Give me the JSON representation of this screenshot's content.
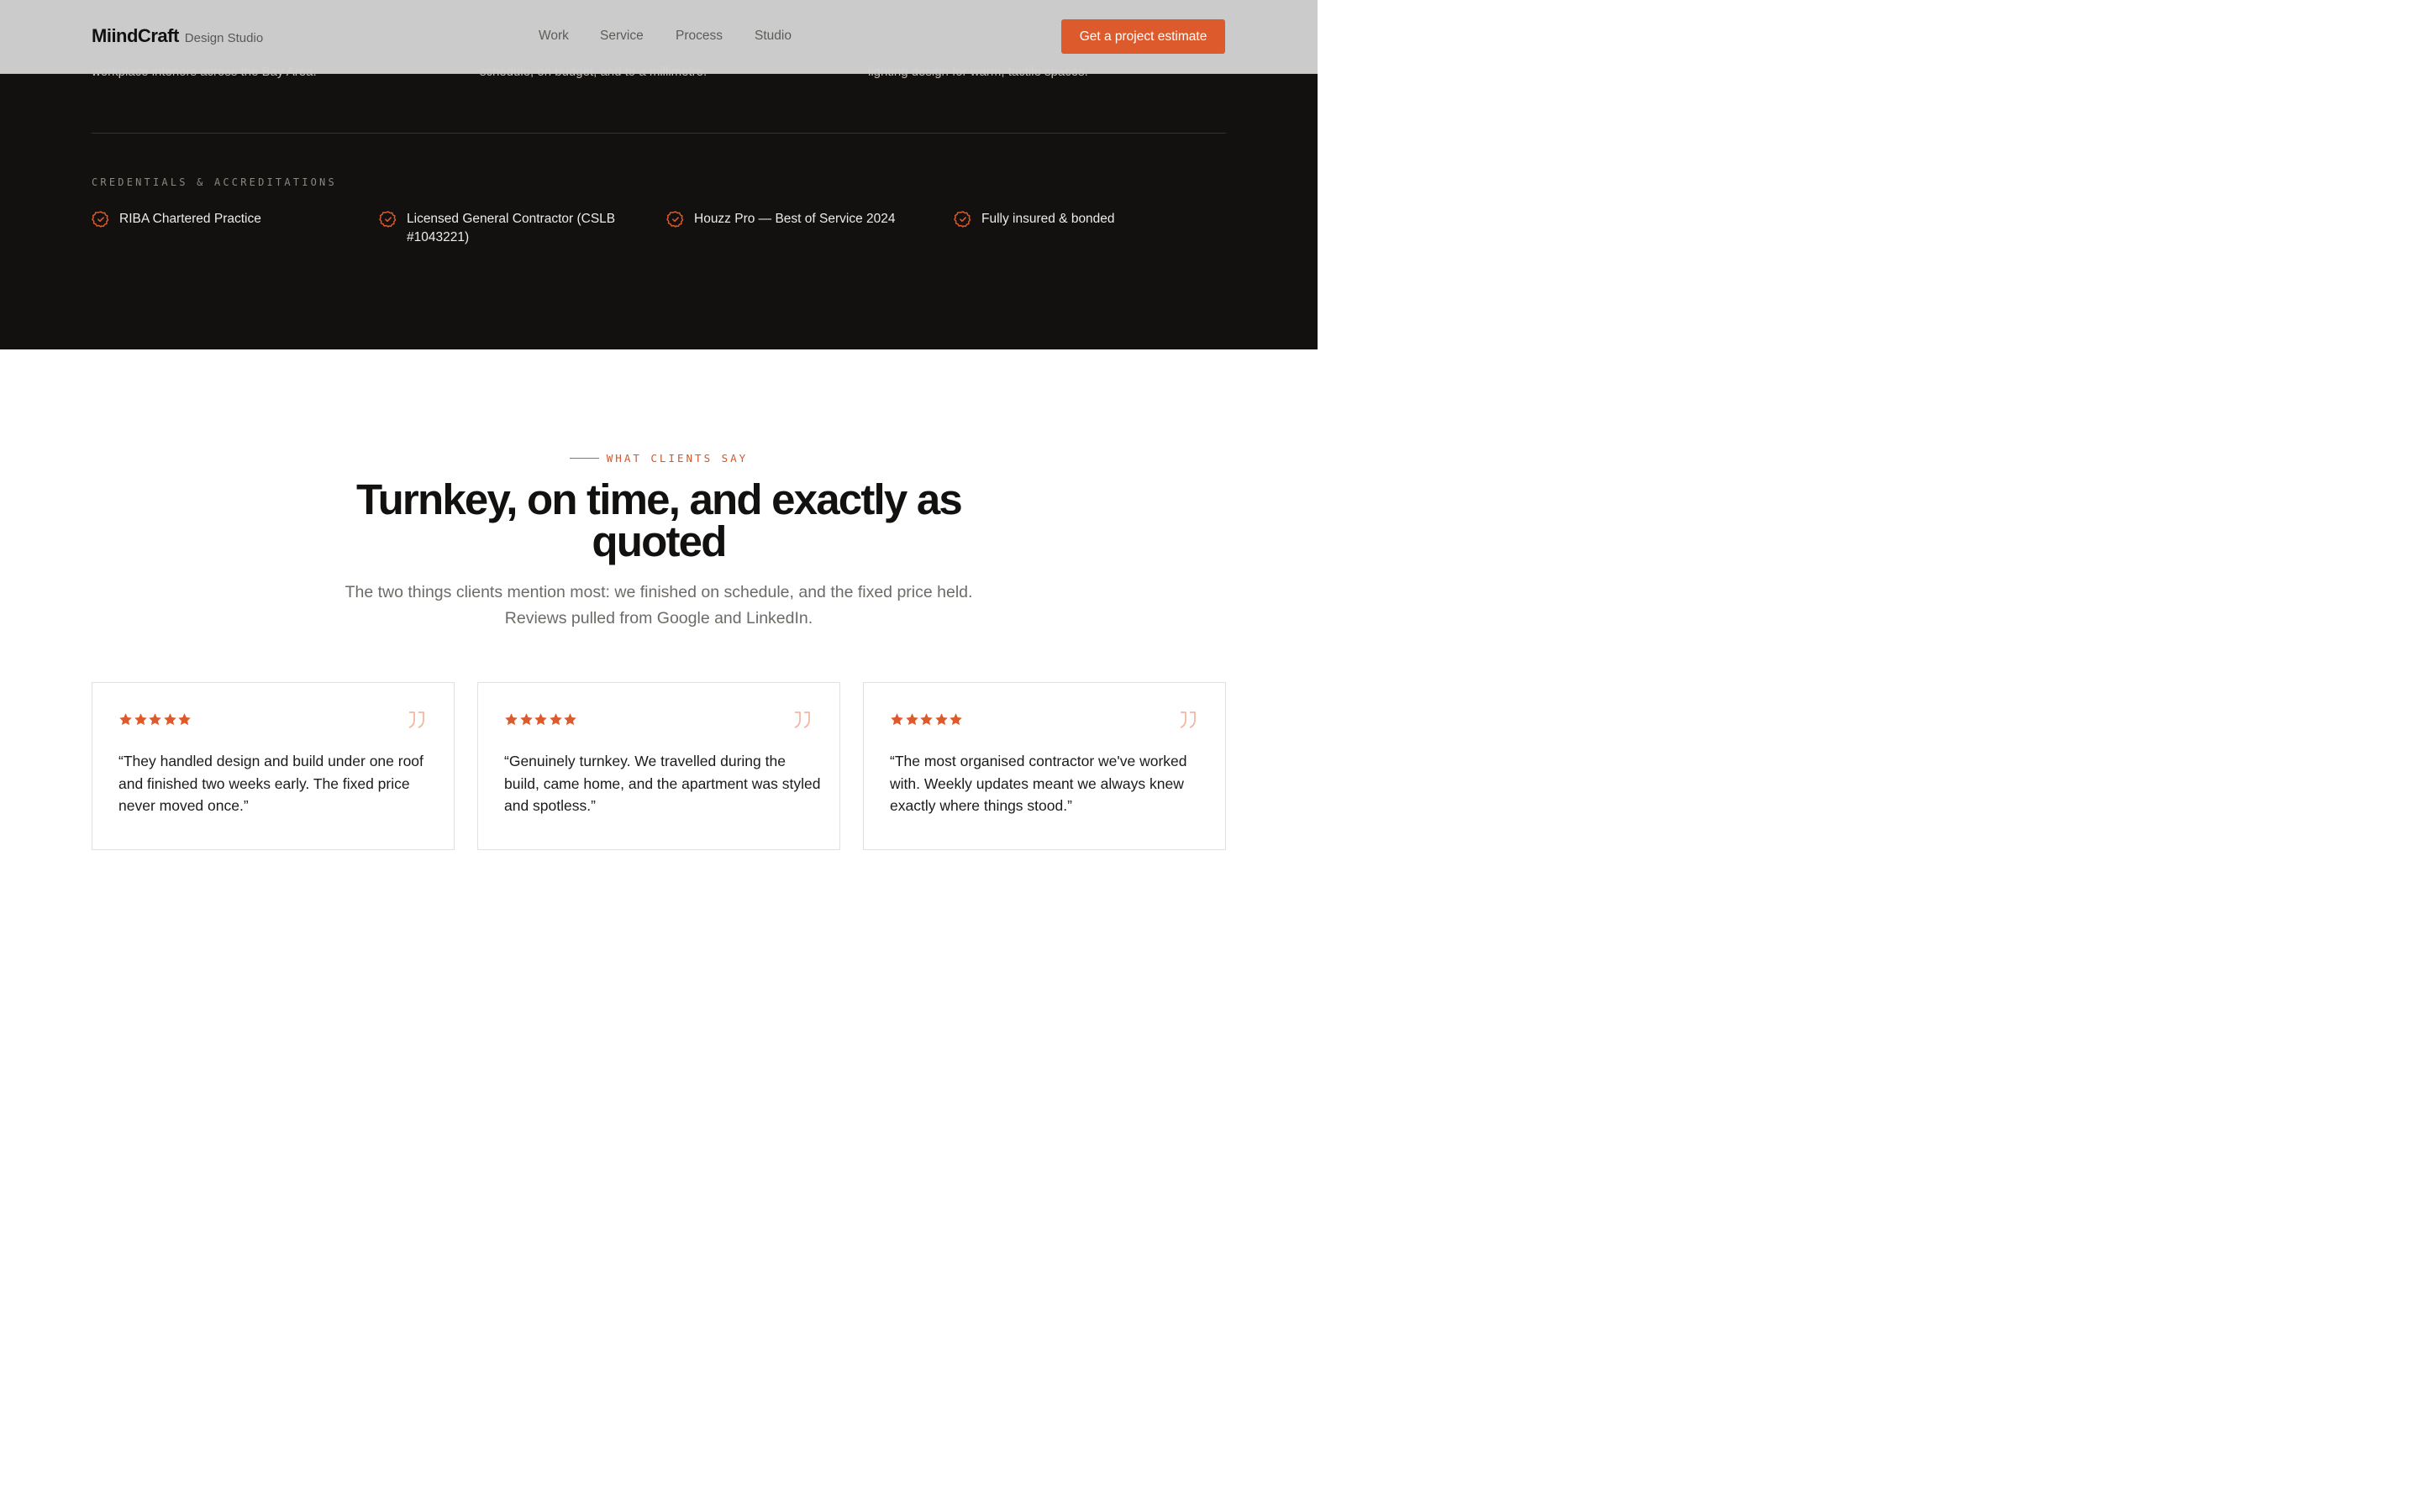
{
  "header": {
    "brand_name": "MiindCraft",
    "brand_sub": "Design Studio",
    "nav": [
      "Work",
      "Service",
      "Process",
      "Studio"
    ],
    "cta": "Get a project estimate"
  },
  "previous_section": {
    "descriptions": [
      "workplace interiors across the Bay Area.",
      "schedule, on budget, and to a millimetre.",
      "lighting design for warm, tactile spaces."
    ]
  },
  "credentials": {
    "heading": "CREDENTIALS & ACCREDITATIONS",
    "items": [
      "RIBA Chartered Practice",
      "Licensed General Contractor (CSLB #1043221)",
      "Houzz Pro — Best of Service 2024",
      "Fully insured & bonded"
    ]
  },
  "testimonials": {
    "eyebrow": "WHAT CLIENTS SAY",
    "title": "Turnkey, on time, and exactly as quoted",
    "lead": "The two things clients mention most: we finished on schedule, and the fixed price held. Reviews pulled from Google and LinkedIn.",
    "cards": [
      {
        "rating": 5,
        "quote": "“They handled design and build under one roof and finished two weeks early. The fixed price never moved once.”"
      },
      {
        "rating": 5,
        "quote": "“Genuinely turnkey. We travelled during the build, came home, and the apartment was styled and spotless.”"
      },
      {
        "rating": 5,
        "quote": "“The most organised contractor we've worked with. Weekly updates meant we always knew exactly where things stood.”"
      }
    ]
  },
  "colors": {
    "accent": "#dd5a2c",
    "dark_bg": "#121110",
    "quote_icon": "#f0b8a1"
  },
  "icons": {
    "credential": "check-badge-icon",
    "rating": "star-icon",
    "quote": "quote-icon"
  }
}
